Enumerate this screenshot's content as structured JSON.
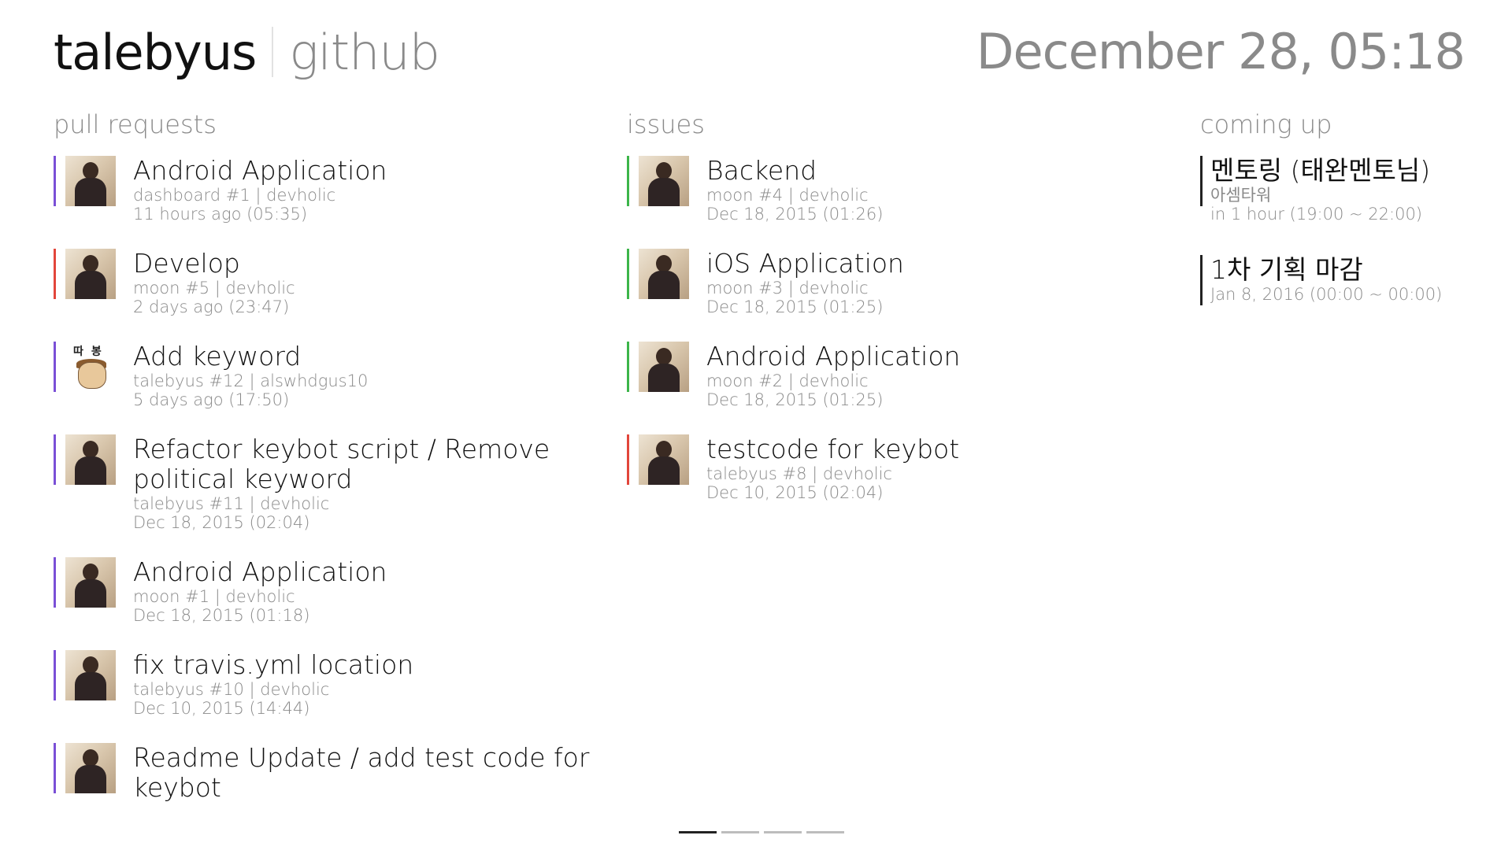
{
  "header": {
    "brand": "talebyus",
    "sub": "github",
    "clock": "December 28, 05:18"
  },
  "pull_requests": {
    "title": "pull requests",
    "items": [
      {
        "title": "Android Application",
        "meta": "dashboard #1 | devholic",
        "time": "11 hours ago (05:35)",
        "color": "#7a4fd6",
        "avatar": "photo"
      },
      {
        "title": "Develop",
        "meta": "moon #5 | devholic",
        "time": "2 days ago (23:47)",
        "color": "#e2463b",
        "avatar": "photo"
      },
      {
        "title": "Add keyword",
        "meta": "talebyus #12 | alswhdgus10",
        "time": "5 days ago (17:50)",
        "color": "#7a4fd6",
        "avatar": "cartoon",
        "cartoon_text": "따봉"
      },
      {
        "title": "Refactor keybot script / Remove political keyword",
        "meta": "talebyus #11 | devholic",
        "time": "Dec 18, 2015 (02:04)",
        "color": "#7a4fd6",
        "avatar": "photo"
      },
      {
        "title": "Android Application",
        "meta": "moon #1 | devholic",
        "time": "Dec 18, 2015 (01:18)",
        "color": "#7a4fd6",
        "avatar": "photo"
      },
      {
        "title": "fix travis.yml location",
        "meta": "talebyus #10 | devholic",
        "time": "Dec 10, 2015 (14:44)",
        "color": "#7a4fd6",
        "avatar": "photo"
      },
      {
        "title": "Readme Update / add test code for keybot",
        "meta": "",
        "time": "",
        "color": "#7a4fd6",
        "avatar": "photo"
      }
    ]
  },
  "issues": {
    "title": "issues",
    "items": [
      {
        "title": "Backend",
        "meta": "moon #4 | devholic",
        "time": "Dec 18, 2015 (01:26)",
        "color": "#3cb54a",
        "avatar": "photo"
      },
      {
        "title": "iOS Application",
        "meta": "moon #3 | devholic",
        "time": "Dec 18, 2015 (01:25)",
        "color": "#3cb54a",
        "avatar": "photo"
      },
      {
        "title": "Android Application",
        "meta": "moon #2 | devholic",
        "time": "Dec 18, 2015 (01:25)",
        "color": "#3cb54a",
        "avatar": "photo"
      },
      {
        "title": "testcode for keybot",
        "meta": "talebyus #8 | devholic",
        "time": "Dec 10, 2015 (02:04)",
        "color": "#e2463b",
        "avatar": "photo"
      }
    ]
  },
  "coming_up": {
    "title": "coming up",
    "items": [
      {
        "title": "멘토링 (태완멘토님)",
        "location": "아셈타워",
        "time": "in 1 hour (19:00 ~ 22:00)"
      },
      {
        "title": "1차 기획 마감",
        "location": "",
        "time": "Jan 8, 2016 (00:00 ~ 00:00)"
      }
    ]
  },
  "pager": {
    "pages": 4,
    "active_index": 0
  }
}
